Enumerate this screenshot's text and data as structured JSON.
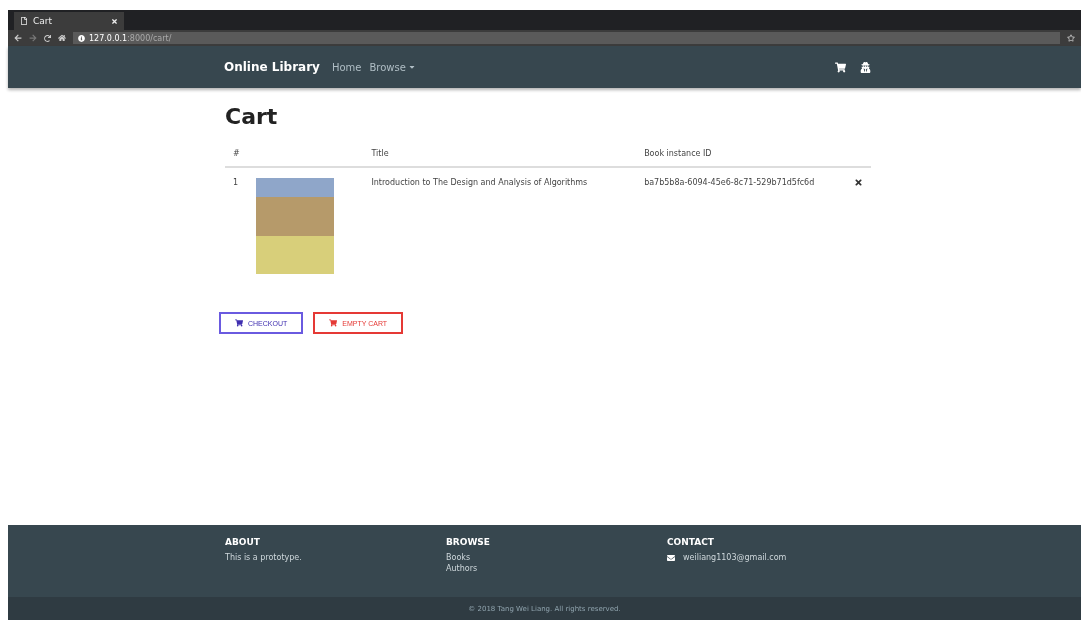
{
  "browser": {
    "tab_title": "Cart",
    "url_host": "127.0.0.1",
    "url_path": ":8000/cart/"
  },
  "navbar": {
    "brand": "Online Library",
    "links": [
      {
        "label": "Home",
        "kind": "link"
      },
      {
        "label": "Browse",
        "kind": "dropdown"
      }
    ]
  },
  "page_title": "Cart",
  "table": {
    "columns": [
      "#",
      "",
      "Title",
      "Book instance ID",
      ""
    ],
    "rows": [
      {
        "index": "1",
        "title": "Introduction to The Design and Analysis of Algorithms",
        "instance_id": "ba7b5b8a-6094-45e6-8c71-529b71d5fc6d"
      }
    ]
  },
  "buttons": [
    {
      "label": "CHECKOUT",
      "kind": "primary"
    },
    {
      "label": "EMPTY CART",
      "kind": "danger"
    }
  ],
  "footer": {
    "about": {
      "heading": "ABOUT",
      "text": "This is a prototype."
    },
    "browse": {
      "heading": "BROWSE",
      "links": [
        "Books",
        "Authors"
      ]
    },
    "contact": {
      "heading": "CONTACT",
      "email": "weiliang1103@gmail.com"
    },
    "copyright": "© 2018 Tang Wei Liang. All rights reserved."
  }
}
